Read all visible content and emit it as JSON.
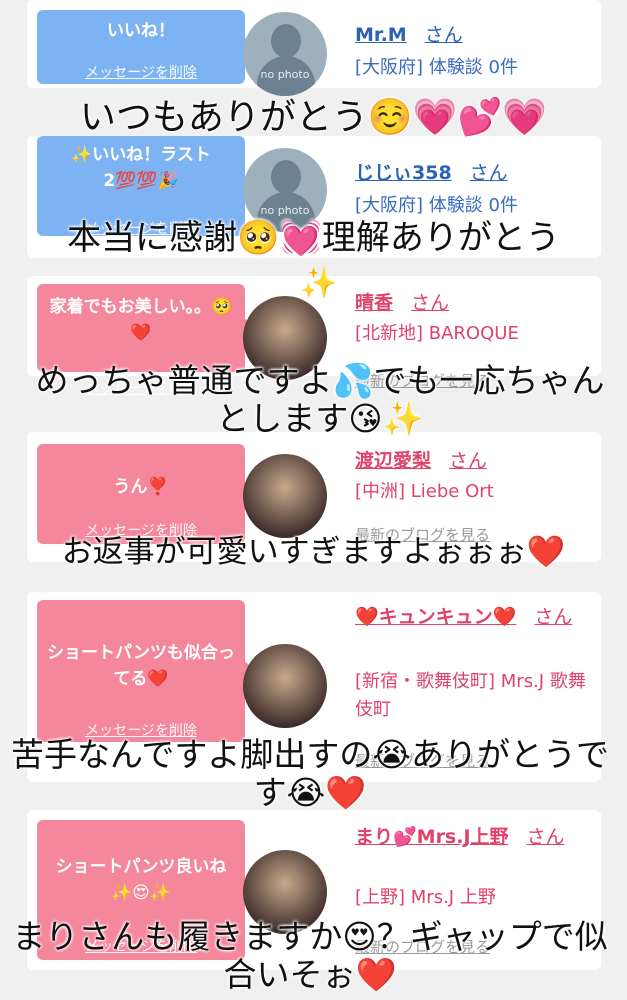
{
  "likes": [
    {
      "bubble": "いいね！",
      "delete_label": "メッセージを削除",
      "name": "Mr.M",
      "san": "さん",
      "info": "[大阪府] 体験談 0件",
      "avatar": "no photo"
    },
    {
      "bubble": "✨いいね！ラスト2💯💯🎉",
      "delete_label": "メッセージを削除",
      "name": "じじぃ358",
      "san": "さん",
      "info": "[大阪府] 体験談 0件",
      "avatar": "no photo"
    },
    {
      "bubble": "家着でもお美しい。。🥺❤️",
      "delete_label": "メッセージを削除",
      "name": "晴香",
      "san": "さん",
      "info": "[北新地] BAROQUE",
      "blog": "最新のブログを見る"
    },
    {
      "bubble": "うん❣️",
      "delete_label": "メッセージを削除",
      "name": "渡辺愛梨",
      "san": "さん",
      "info": "[中洲] Liebe Ort",
      "blog": "最新のブログを見る"
    },
    {
      "bubble": "ショートパンツも似合ってる❤️",
      "delete_label": "メッセージを削除",
      "name": "❤️キュンキュン❤️",
      "san": "さん",
      "info": "[新宿・歌舞伎町] Mrs.J 歌舞伎町",
      "blog": "最新のブログを見る"
    },
    {
      "bubble": "ショートパンツ良いね✨😍✨",
      "delete_label": "メッセージを削除",
      "name": "まり💕Mrs.J上野",
      "san": "さん",
      "info": "[上野] Mrs.J 上野",
      "blog": "最新のブログを見る"
    }
  ],
  "captions": [
    "いつもありがとう☺️💗💕💗",
    "本当に感謝🥺💓理解ありがとう",
    "✨",
    "めっちゃ普通ですよ💦でも一応ちゃんとします😘✨",
    "お返事が可愛いすぎますよぉぉぉ❤️",
    "苦手なんですよ脚出すの😭ありがとうです😭❤️",
    "まりさんも履きますか😍？ギャップで似合いそぉ❤️"
  ],
  "colors": {
    "blue_accent": "#7eb3f3",
    "pink_accent": "#f5879d",
    "name_blue": "#2b62b5",
    "name_pink": "#e0426a"
  }
}
